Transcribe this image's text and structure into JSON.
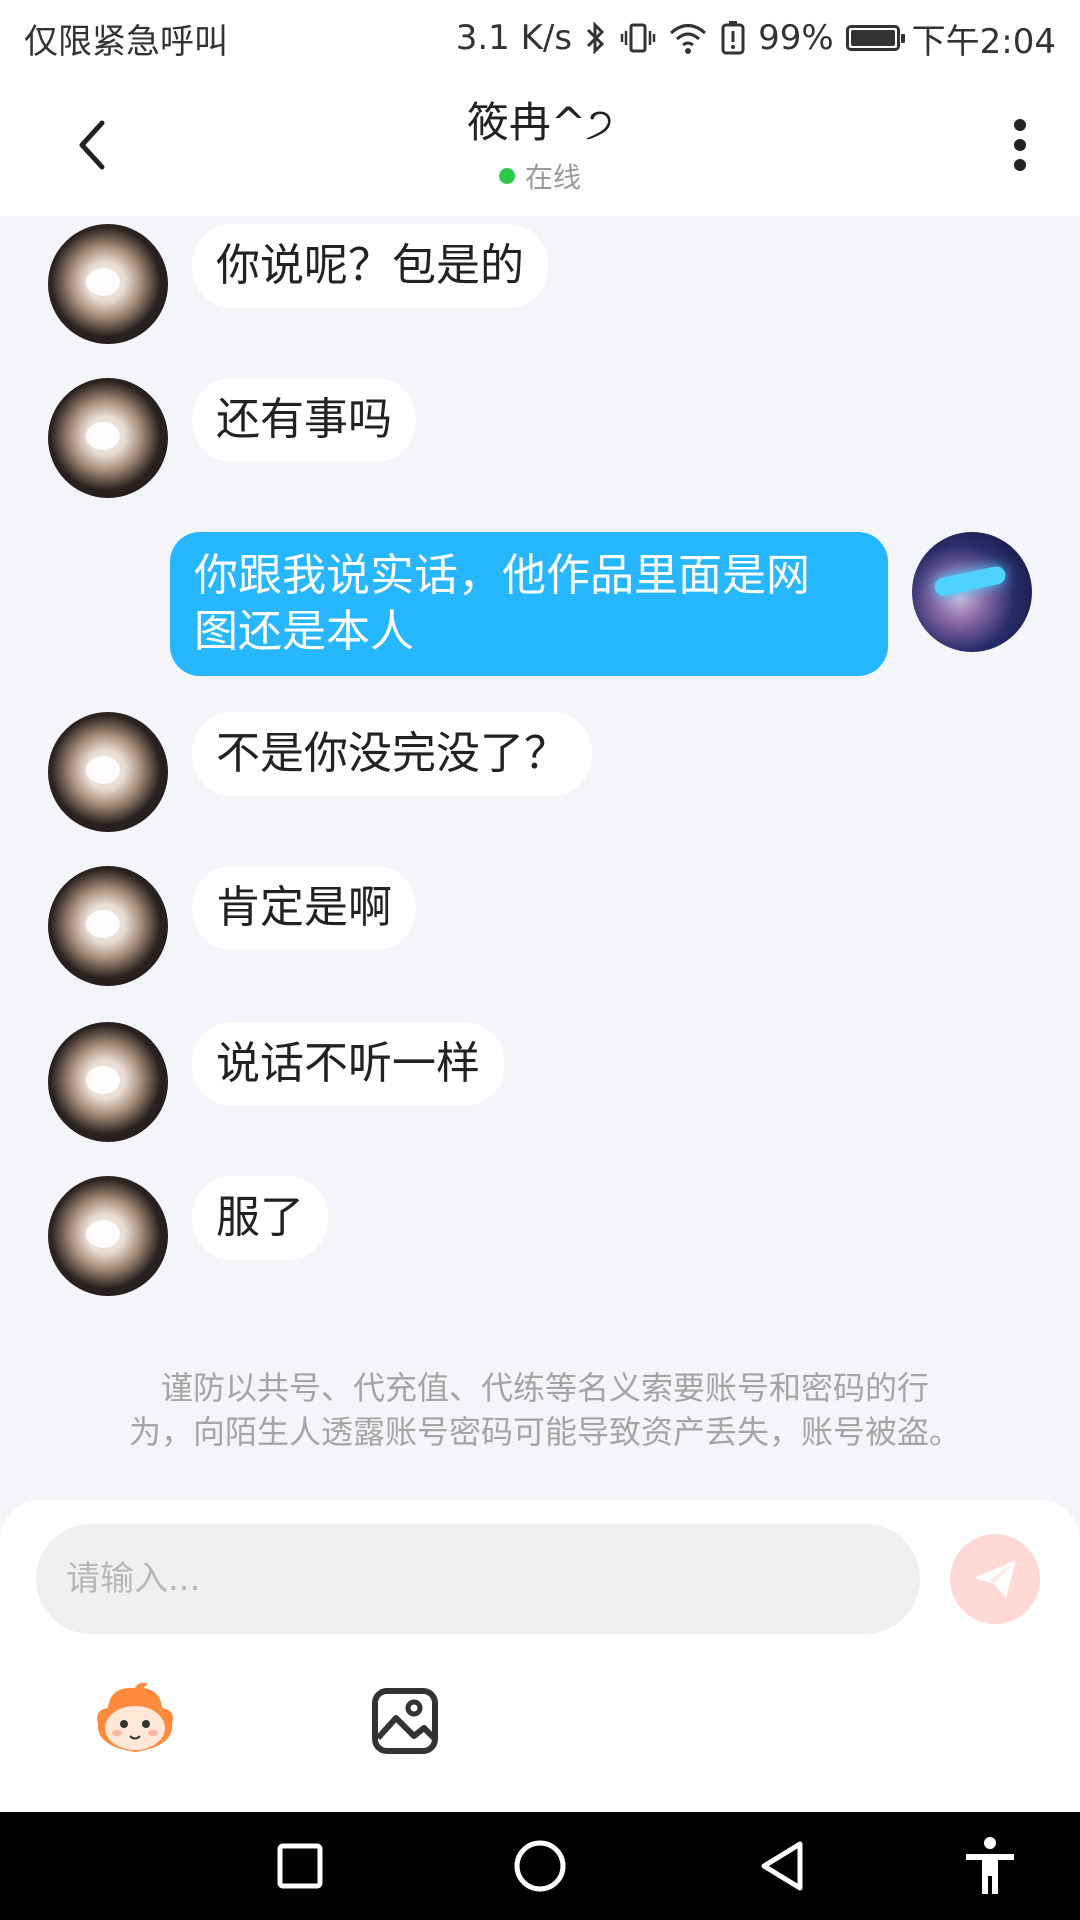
{
  "status_bar": {
    "left_text": "仅限紧急呼叫",
    "network_speed": "3.1 K/s",
    "battery_percent": "99%",
    "time": "下午2:04"
  },
  "header": {
    "title": "筱冉^੭",
    "presence": "在线"
  },
  "messages": [
    {
      "side": "left",
      "text": "你说呢？包是的"
    },
    {
      "side": "left",
      "text": "还有事吗"
    },
    {
      "side": "right",
      "line1": "你跟我说实话，他作品里面是网",
      "line2": "图还是本人"
    },
    {
      "side": "left",
      "text": "不是你没完没了？"
    },
    {
      "side": "left",
      "text": "肯定是啊"
    },
    {
      "side": "left",
      "text": "说话不听一样"
    },
    {
      "side": "left",
      "text": "服了"
    }
  ],
  "notice": {
    "line1": "谨防以共号、代充值、代练等名义索要账号和密码的行",
    "line2": "为，向陌生人透露账号密码可能导致资产丢失，账号被盗。"
  },
  "composer": {
    "placeholder": "请输入..."
  },
  "colors": {
    "my_bubble": "#26b7ff",
    "online_dot": "#2ec94a",
    "send_button": "#ffd9d6"
  }
}
